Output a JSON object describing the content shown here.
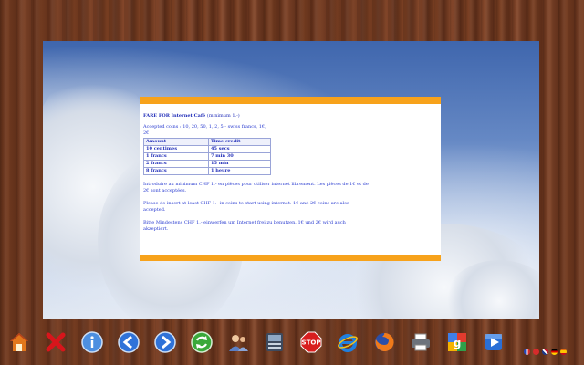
{
  "fare_table": {
    "title_bold": "FARE FOR Internet Café",
    "title_note": "(minimum 1.-)",
    "accepted_coins": "Accepted coins : 10, 20, 50, 1, 2, 5 - swiss francs, 1€, 2€",
    "headers": [
      "Amount",
      "Time credit"
    ],
    "rows": [
      [
        "10 centimes",
        "45 secs"
      ],
      [
        "1 francs",
        "7 min 30"
      ],
      [
        "2 francs",
        "15 min"
      ],
      [
        "8 francs",
        "1 heure"
      ]
    ]
  },
  "instructions": {
    "fr": "Introduire au minimum CHF 1.- en pièces pour utiliser internet librement. Les pièces de 1€ et de 2€ sont acceptées.",
    "en": "Please do insert at least CHF 1.- in coins to start using internet. 1€ and 2€ coins are also accepted.",
    "de": "Bitte Mindestens CHF 1.- einwerfen um Internet frei zu benutzen. 1€ und 2€ wird auch akzeptiert."
  },
  "colors": {
    "accent": "#f7a21b",
    "text_blue": "#2a3cd0",
    "wood": "#6b3520"
  },
  "taskbar_icons": [
    "home-icon",
    "close-x-icon",
    "info-icon",
    "back-arrow-icon",
    "forward-arrow-icon",
    "refresh-icon",
    "user-chat-icon",
    "keyboard-icon",
    "stop-sign-icon",
    "internet-explorer-icon",
    "firefox-icon",
    "printer-icon",
    "google-icon",
    "media-player-icon"
  ],
  "stop_label": "STOP",
  "tray_flags": [
    "fr-flag-icon",
    "ch-flag-icon",
    "uk-flag-icon",
    "de-flag-icon",
    "es-flag-icon"
  ]
}
